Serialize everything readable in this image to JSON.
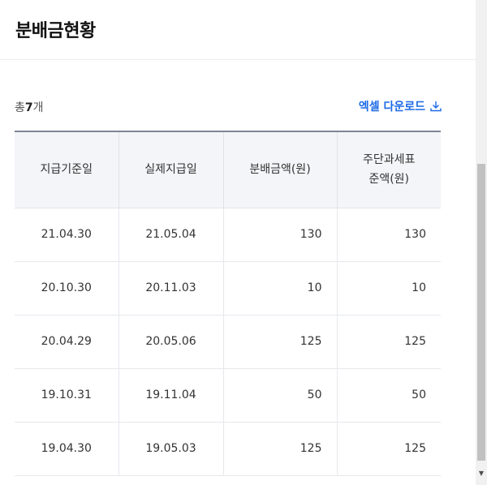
{
  "header": {
    "title": "분배금현황"
  },
  "summary": {
    "prefix": "총",
    "count": "7",
    "suffix": "개"
  },
  "excel": {
    "label": "엑셀 다운로드",
    "icon": "download-icon"
  },
  "table": {
    "columns": [
      "지급기준일",
      "실제지급일",
      "분배금액(원)",
      "주단과세표",
      "준액(원)"
    ],
    "rows": [
      [
        "21.04.30",
        "21.05.04",
        "130",
        "130"
      ],
      [
        "20.10.30",
        "20.11.03",
        "10",
        "10"
      ],
      [
        "20.04.29",
        "20.05.06",
        "125",
        "125"
      ],
      [
        "19.10.31",
        "19.11.04",
        "50",
        "50"
      ],
      [
        "19.04.30",
        "19.05.03",
        "125",
        "125"
      ]
    ]
  },
  "colors": {
    "accent": "#1c6ae6",
    "header_bg": "#f3f5f8",
    "border": "#7c8595"
  }
}
